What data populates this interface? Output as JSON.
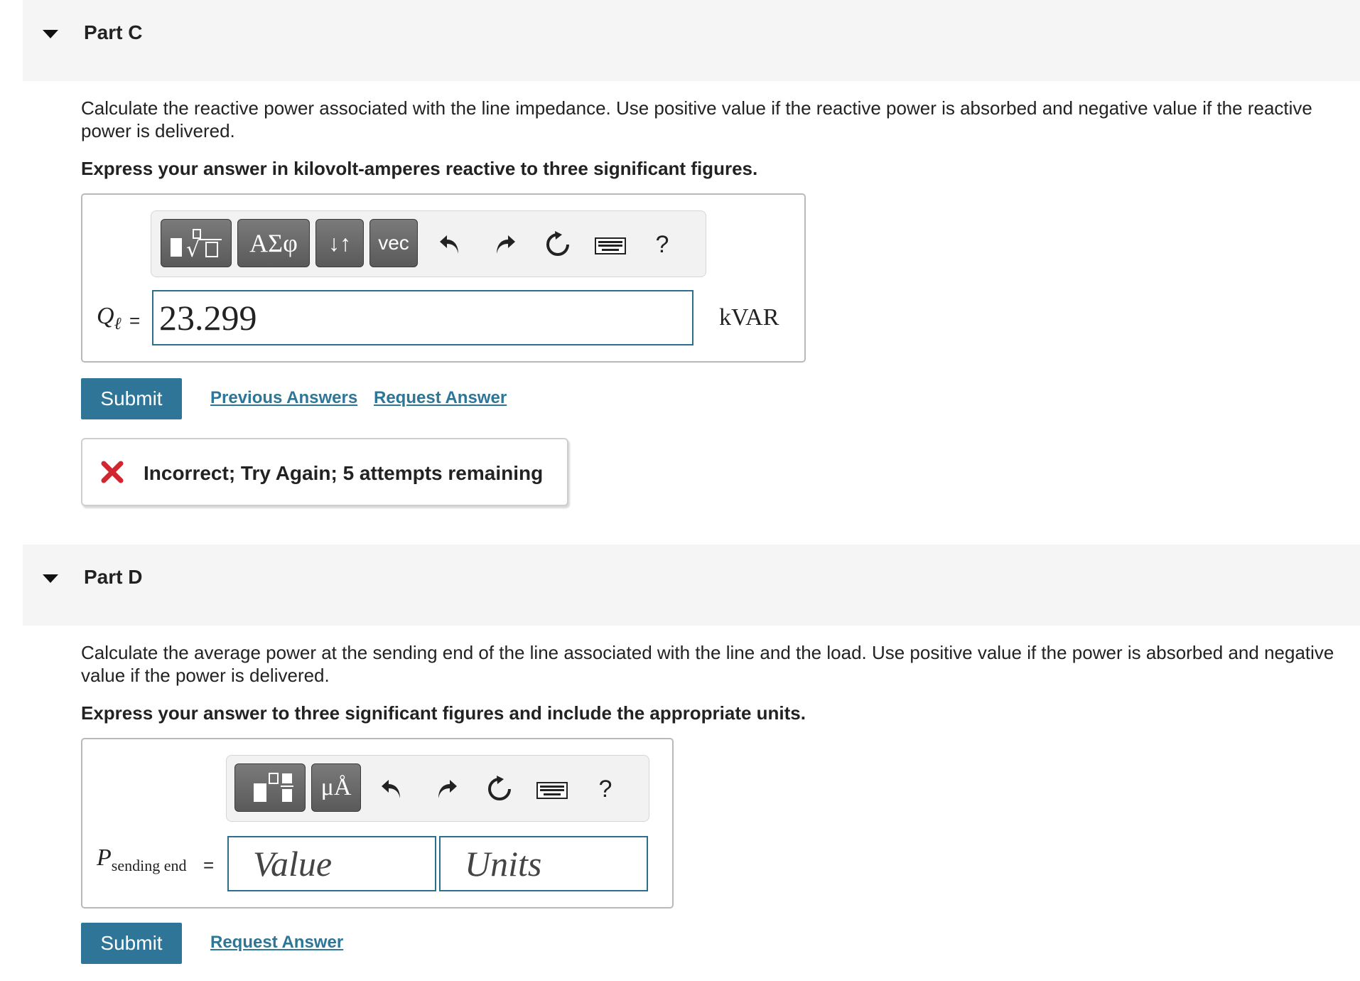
{
  "partC": {
    "title": "Part C",
    "prompt": "Calculate the reactive power associated with the line impedance. Use positive value if the reactive power is absorbed and negative value if the reactive power is delivered.",
    "instruction": "Express your answer in kilovolt-amperes reactive to three significant figures.",
    "toolbar": {
      "greek_label": "ΑΣφ",
      "arrows_label": "↓↑",
      "vec_label": "vec",
      "help_label": "?"
    },
    "var_symbol": "Q",
    "var_subscript": "ℓ",
    "equals": "=",
    "answer_value": "23.299",
    "unit": "kVAR",
    "submit_label": "Submit",
    "previous_answers_label": "Previous Answers",
    "request_answer_label": "Request Answer",
    "feedback": "Incorrect; Try Again; 5 attempts remaining"
  },
  "partD": {
    "title": "Part D",
    "prompt": "Calculate the average power at the sending end of the line associated with the line and the load. Use positive value if the power is absorbed and negative value if the power is delivered.",
    "instruction": "Express your answer to three significant figures and include the appropriate units.",
    "toolbar": {
      "units_label": "μÅ",
      "help_label": "?"
    },
    "var_symbol": "P",
    "var_subscript": "sending end",
    "equals": "=",
    "value_placeholder": "Value",
    "units_placeholder": "Units",
    "submit_label": "Submit",
    "request_answer_label": "Request Answer"
  },
  "colors": {
    "accent": "#2e7597",
    "error": "#d0262f",
    "header_bg": "#f5f5f5"
  },
  "icons": [
    "collapse-triangle-icon",
    "templates-icon",
    "undo-icon",
    "redo-icon",
    "reset-icon",
    "keyboard-icon",
    "incorrect-x-icon"
  ]
}
